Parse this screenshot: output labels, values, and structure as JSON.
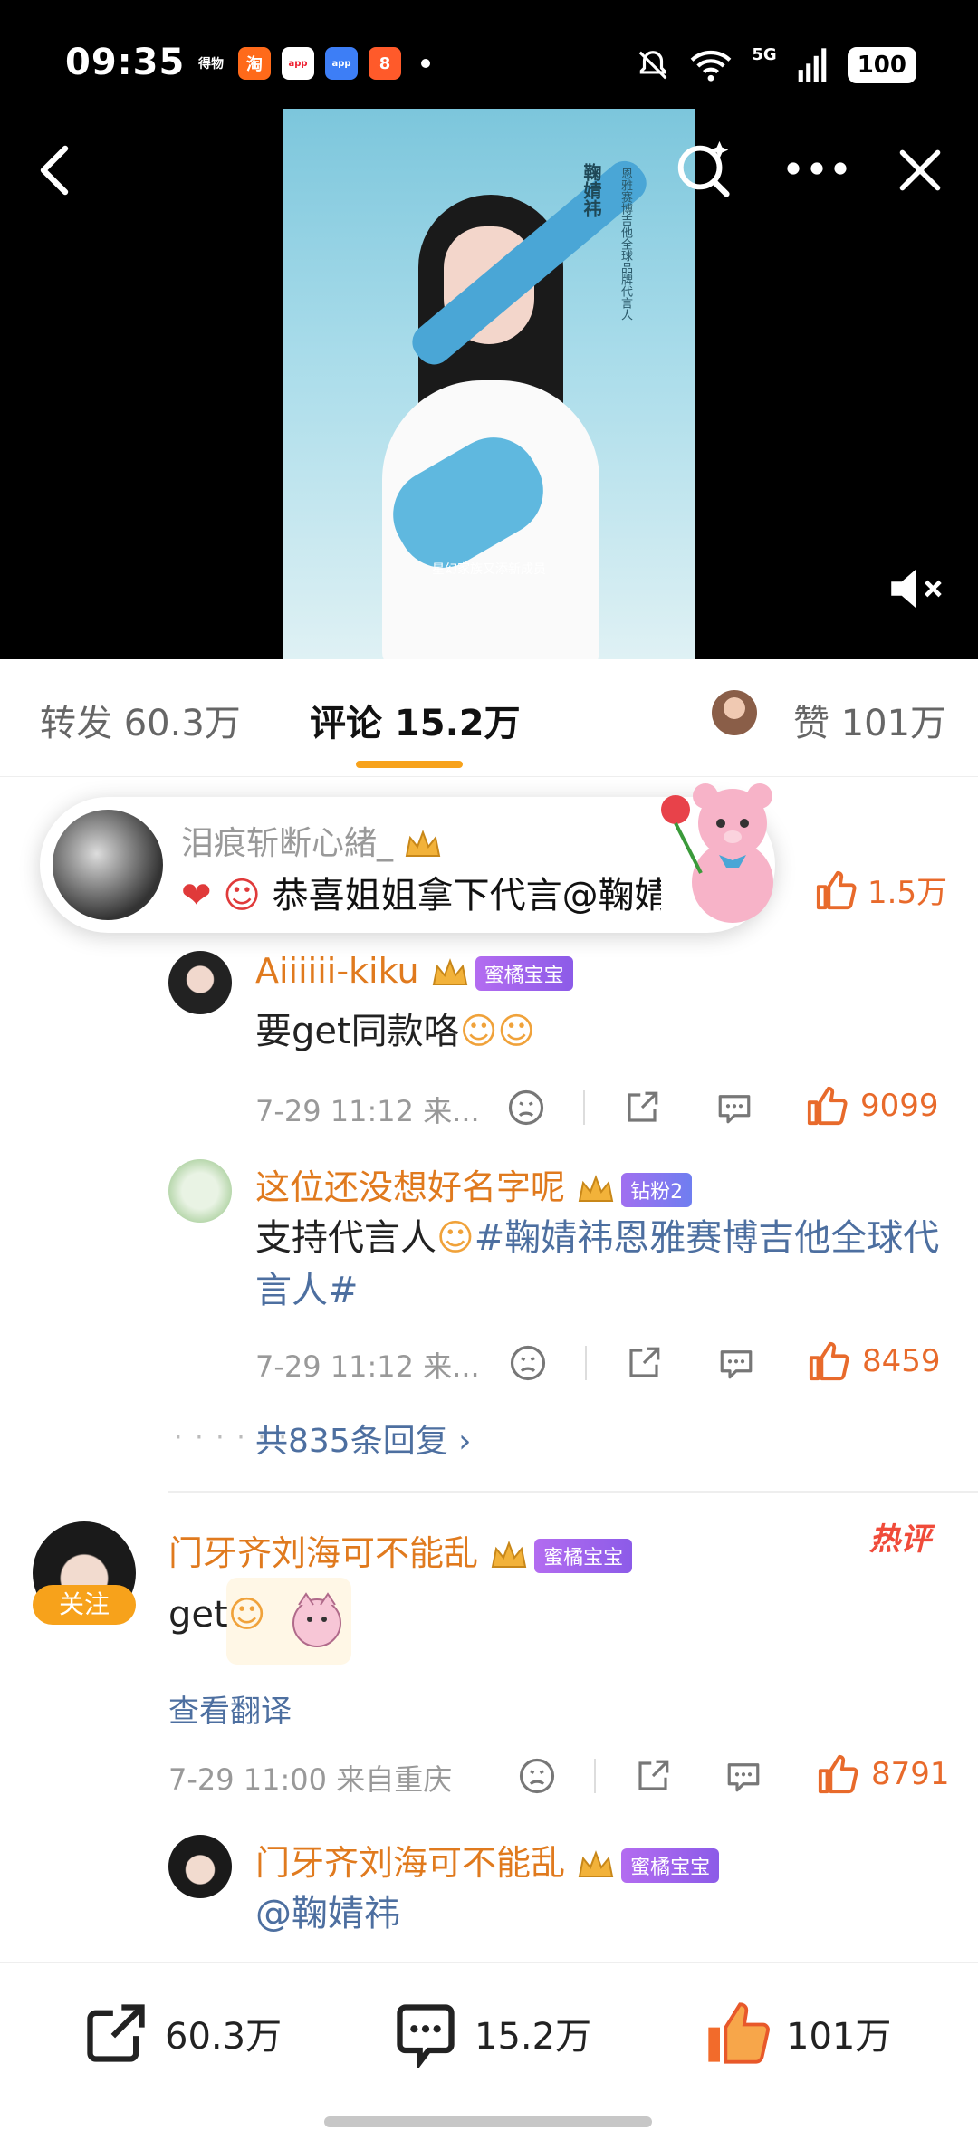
{
  "status_bar": {
    "time": "09:35",
    "network": "5G",
    "battery": "100",
    "app_icon_1": "得物",
    "app_icon_2": "淘",
    "app_icon_3": "app",
    "app_icon_4": "app",
    "app_icon_5": "8"
  },
  "poster": {
    "vertical_title": "鞠婧祎",
    "vertical_subtitle": "恩雅赛博吉他全球品牌代言人",
    "caption": "星幻家族又添新成员"
  },
  "tabs": {
    "repost": "转发 60.3万",
    "comment": "评论 15.2万",
    "like": "赞 101万"
  },
  "banner": {
    "name": "泪痕斩断心緒_",
    "text": "恭喜姐姐拿下代言@鞠婧"
  },
  "left_likes": "1.5万",
  "comments": [
    {
      "name": "Aiiiiii-kiku",
      "badge": "蜜橘宝宝",
      "text": "要get同款咯",
      "meta": "7-29 11:12  来...",
      "likes": "9099"
    },
    {
      "name": "这位还没想好名字呢",
      "badge": "钻粉2",
      "text_prefix": "支持代言人",
      "topic": "#鞠婧祎恩雅赛博吉他全球代言人#",
      "meta": "7-29 11:12  来...",
      "likes": "8459"
    }
  ],
  "more_replies": "共835条回复 ›",
  "main_comment": {
    "name": "门牙齐刘海可不能乱",
    "badge": "蜜橘宝宝",
    "follow": "关注",
    "hot": "热评",
    "text": "get",
    "translate": "查看翻译",
    "meta": "7-29 11:00  来自重庆",
    "likes": "8791"
  },
  "reply": {
    "name": "门牙齐刘海可不能乱",
    "badge": "蜜橘宝宝",
    "text": "@鞠婧祎"
  },
  "bottom_bar": {
    "repost": "60.3万",
    "comment": "15.2万",
    "like": "101万"
  },
  "colors": {
    "accent_orange": "#f7a21b",
    "name_orange": "#e07a1e",
    "like_orange": "#e86a2b",
    "topic_blue": "#4d6fa0",
    "hot_red": "#f04b3a"
  }
}
